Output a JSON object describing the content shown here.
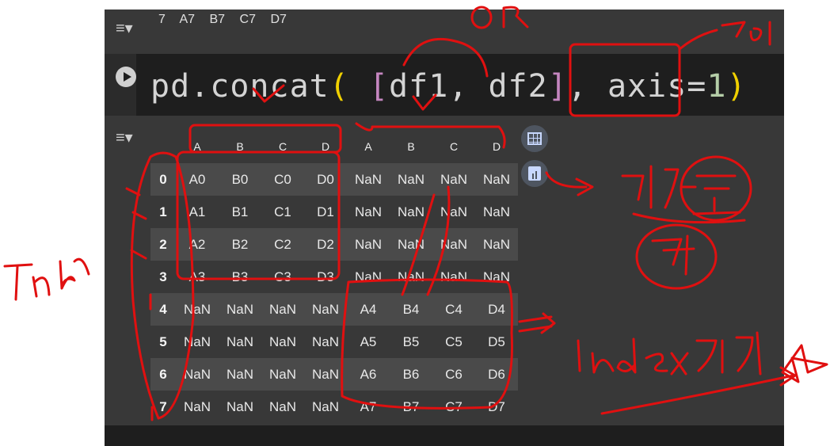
{
  "previous_row": [
    "7",
    "A7",
    "B7",
    "C7",
    "D7"
  ],
  "code": {
    "func": "pd.concat",
    "open_paren": "(",
    "open_bracket": "[",
    "args": "df1, df2",
    "close_bracket": "]",
    "kw": ", axis=",
    "value": "1",
    "close_paren": ")"
  },
  "dataframe": {
    "columns": [
      "A",
      "B",
      "C",
      "D",
      "A",
      "B",
      "C",
      "D"
    ],
    "rows": [
      {
        "index": "0",
        "values": [
          "A0",
          "B0",
          "C0",
          "D0",
          "NaN",
          "NaN",
          "NaN",
          "NaN"
        ]
      },
      {
        "index": "1",
        "values": [
          "A1",
          "B1",
          "C1",
          "D1",
          "NaN",
          "NaN",
          "NaN",
          "NaN"
        ]
      },
      {
        "index": "2",
        "values": [
          "A2",
          "B2",
          "C2",
          "D2",
          "NaN",
          "NaN",
          "NaN",
          "NaN"
        ]
      },
      {
        "index": "3",
        "values": [
          "A3",
          "B3",
          "C3",
          "D3",
          "NaN",
          "NaN",
          "NaN",
          "NaN"
        ]
      },
      {
        "index": "4",
        "values": [
          "NaN",
          "NaN",
          "NaN",
          "NaN",
          "A4",
          "B4",
          "C4",
          "D4"
        ]
      },
      {
        "index": "5",
        "values": [
          "NaN",
          "NaN",
          "NaN",
          "NaN",
          "A5",
          "B5",
          "C5",
          "D5"
        ]
      },
      {
        "index": "6",
        "values": [
          "NaN",
          "NaN",
          "NaN",
          "NaN",
          "A6",
          "B6",
          "C6",
          "D6"
        ]
      },
      {
        "index": "7",
        "values": [
          "NaN",
          "NaN",
          "NaN",
          "NaN",
          "A7",
          "B7",
          "C7",
          "D7"
        ]
      }
    ]
  },
  "icons": {
    "output_toggle": "output-expand-icon",
    "run": "play-icon",
    "table": "table-icon",
    "chart": "bar-chart-icon"
  },
  "annotation_color": "#e01010"
}
